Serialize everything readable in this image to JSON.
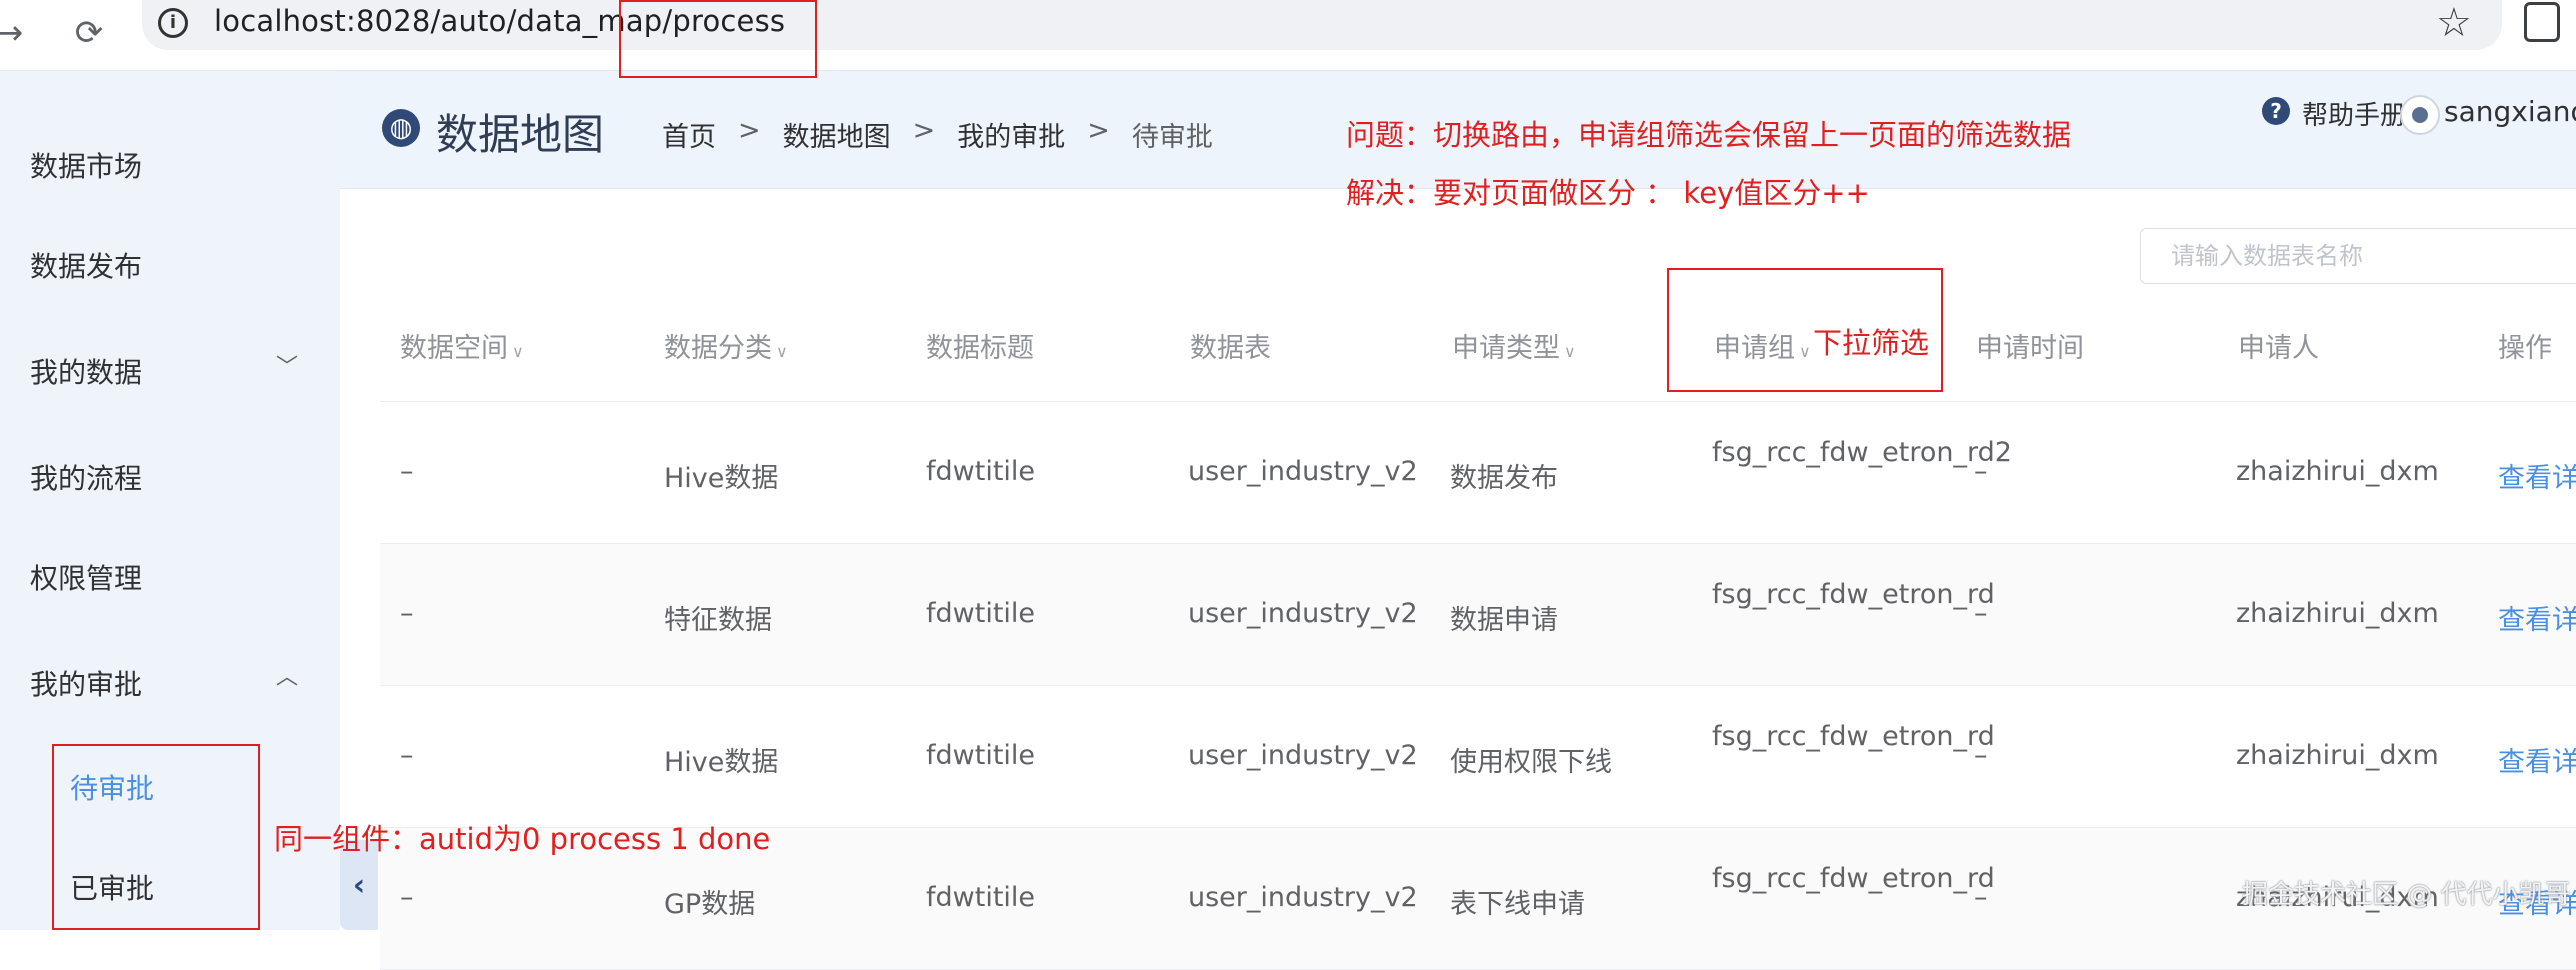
{
  "browser": {
    "url": "localhost:8028/auto/data_map/process"
  },
  "sidebar": {
    "items": [
      {
        "label": "数据市场"
      },
      {
        "label": "数据发布"
      },
      {
        "label": "我的数据"
      },
      {
        "label": "我的流程"
      },
      {
        "label": "权限管理"
      },
      {
        "label": "我的审批"
      }
    ],
    "sub_items": [
      {
        "label": "待审批",
        "active": true
      },
      {
        "label": "已审批",
        "active": false
      }
    ]
  },
  "header": {
    "title": "数据地图",
    "breadcrumb": [
      "首页",
      "数据地图",
      "我的审批",
      "待审批"
    ],
    "breadcrumb_separator": ">",
    "help": "帮助手册",
    "username": "sangxiande"
  },
  "annotations": {
    "problem": "问题：切换路由，申请组筛选会保留上一页面的筛选数据",
    "solution": "解决：要对页面做区分 ： key值区分++",
    "dropdown": "下拉筛选",
    "component": "同一组件：autid为0 process 1 done"
  },
  "search": {
    "placeholder": "请输入数据表名称"
  },
  "table": {
    "columns": [
      {
        "label": "数据空间",
        "filter": true
      },
      {
        "label": "数据分类",
        "filter": true
      },
      {
        "label": "数据标题",
        "filter": false
      },
      {
        "label": "数据表",
        "filter": false
      },
      {
        "label": "申请类型",
        "filter": true
      },
      {
        "label": "申请组",
        "filter": true
      },
      {
        "label": "申请时间",
        "filter": false
      },
      {
        "label": "申请人",
        "filter": false
      },
      {
        "label": "操作",
        "filter": false
      }
    ],
    "rows": [
      {
        "space": "–",
        "category": "Hive数据",
        "title": "fdwtitile",
        "table": "user_industry_v2",
        "type": "数据发布",
        "group": "fsg_rcc_fdw_etron_rd2",
        "time": "–",
        "applicant": "zhaizhirui_dxm",
        "action": "查看详情"
      },
      {
        "space": "–",
        "category": "特征数据",
        "title": "fdwtitile",
        "table": "user_industry_v2",
        "type": "数据申请",
        "group": "fsg_rcc_fdw_etron_rd",
        "time": "–",
        "applicant": "zhaizhirui_dxm",
        "action": "查看详情"
      },
      {
        "space": "–",
        "category": "Hive数据",
        "title": "fdwtitile",
        "table": "user_industry_v2",
        "type": "使用权限下线",
        "group": "fsg_rcc_fdw_etron_rd",
        "time": "–",
        "applicant": "zhaizhirui_dxm",
        "action": "查看详情"
      },
      {
        "space": "–",
        "category": "GP数据",
        "title": "fdwtitile",
        "table": "user_industry_v2",
        "type": "表下线申请",
        "group": "fsg_rcc_fdw_etron_rd",
        "time": "–",
        "applicant": "zhaizhirui_dxm",
        "action": "查看详情"
      }
    ]
  },
  "watermark": "掘金技术社区 @ 代代小凯哥",
  "colors": {
    "accent": "#4a90e2",
    "annotation": "#e02020",
    "sidebar_bg": "#eff4fb"
  }
}
